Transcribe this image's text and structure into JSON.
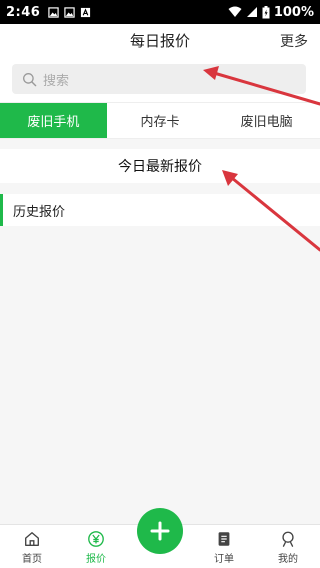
{
  "status_bar": {
    "time": "2:46",
    "battery_text": "100%",
    "icons": [
      "image-icon",
      "image-icon",
      "text-icon",
      "wifi-icon",
      "signal-icon",
      "battery-icon"
    ]
  },
  "header": {
    "title": "每日报价",
    "more_label": "更多"
  },
  "search": {
    "placeholder": "搜索",
    "icon": "search-icon"
  },
  "tabs": [
    {
      "label": "废旧手机",
      "active": true
    },
    {
      "label": "内存卡",
      "active": false
    },
    {
      "label": "废旧电脑",
      "active": false
    }
  ],
  "today_label": "今日最新报价",
  "history_label": "历史报价",
  "bottom_nav": {
    "items": [
      {
        "label": "首页",
        "icon": "home-icon",
        "active": false
      },
      {
        "label": "报价",
        "icon": "yen-icon",
        "active": true
      },
      {
        "label": "订单",
        "icon": "document-icon",
        "active": false
      },
      {
        "label": "我的",
        "icon": "user-icon",
        "active": false
      }
    ],
    "center_action_icon": "plus-icon"
  },
  "colors": {
    "accent": "#1fb94a",
    "annotation_arrow": "#d9363e"
  }
}
